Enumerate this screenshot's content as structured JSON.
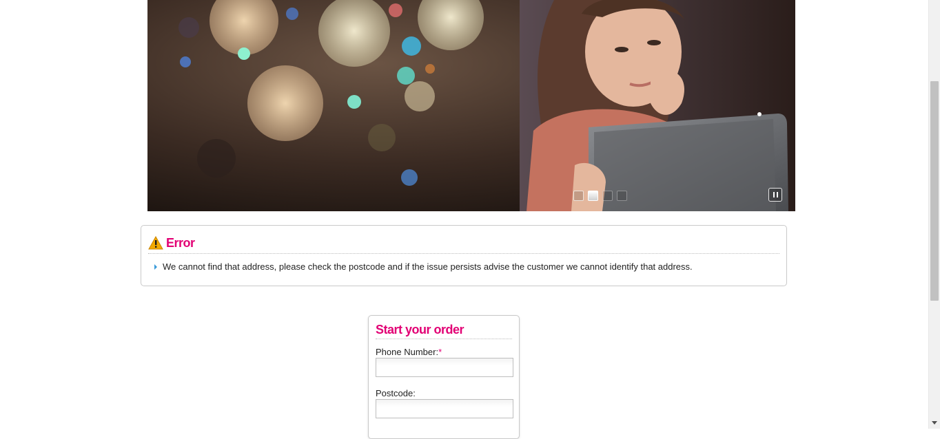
{
  "banner": {
    "slides_count": 4,
    "active_slide": 2,
    "pause_icon": "pause-icon"
  },
  "error": {
    "icon": "warning-icon",
    "title": "Error",
    "message": "We cannot find that address, please check the postcode and if the issue persists advise the customer we cannot identify that address."
  },
  "order_form": {
    "title": "Start your order",
    "phone_label": "Phone Number:",
    "required_marker": "*",
    "phone_value": "",
    "postcode_label": "Postcode:",
    "postcode_value": ""
  },
  "colors": {
    "accent": "#e20074",
    "bullet": "#3a9bd9"
  }
}
